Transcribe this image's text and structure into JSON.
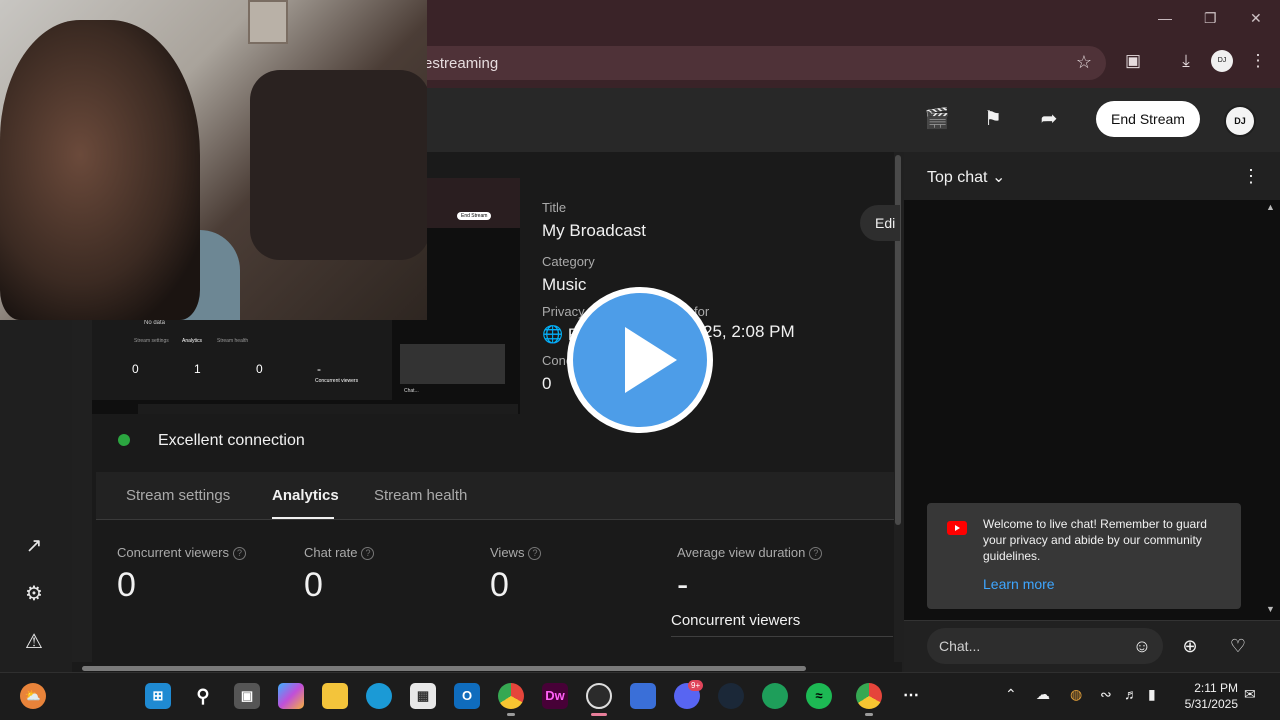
{
  "browser": {
    "url_fragment": "estreaming",
    "window_controls": [
      "minimize-icon",
      "restore-icon",
      "close-icon"
    ]
  },
  "header": {
    "end_stream_label": "End Stream",
    "icons": [
      "clapperboard-icon",
      "bookmark-icon",
      "share-icon"
    ],
    "avatar_text": "DJ"
  },
  "stream_info": {
    "title_label": "Title",
    "title_value": "My Broadcast",
    "category_label": "Category",
    "category_value": "Music",
    "privacy_label": "Privacy",
    "privacy_value": "P",
    "scheduled_label": "for",
    "scheduled_value": "25, 2:08 PM",
    "concurrent_label": "Conc",
    "concurrent_value": "0",
    "edit_label": "Edi"
  },
  "connection": {
    "status": "Excellent connection",
    "color": "#2ba640"
  },
  "tabs": [
    {
      "label": "Stream settings",
      "active": false
    },
    {
      "label": "Analytics",
      "active": true
    },
    {
      "label": "Stream health",
      "active": false
    }
  ],
  "stats": [
    {
      "label": "Concurrent viewers",
      "value": "0"
    },
    {
      "label": "Chat rate",
      "value": "0"
    },
    {
      "label": "Views",
      "value": "0"
    },
    {
      "label": "Average view duration",
      "value": "-"
    }
  ],
  "concurrent_viewers_title": "Concurrent viewers",
  "preview_mini": {
    "no_data": "No data",
    "tabs": [
      "Stream settings",
      "Analytics",
      "Stream health"
    ],
    "stats": [
      "0",
      "1",
      "0",
      "-"
    ],
    "cv": "Concurrent viewers",
    "end_stream": "End Stream",
    "chat": "Chat..."
  },
  "chat": {
    "mode_label": "Top chat",
    "welcome_text": "Welcome to live chat! Remember to guard your privacy and abide by our community guidelines.",
    "learn_more": "Learn more",
    "input_placeholder": "Chat..."
  },
  "taskbar": {
    "apps": [
      "windows-start",
      "search",
      "task-view",
      "copilot",
      "file-explorer",
      "edge",
      "microsoft-store",
      "outlook",
      "chrome",
      "dreamweaver",
      "obs",
      "screen-recorder",
      "discord",
      "steam",
      "kiwix",
      "spotify",
      "chrome-profile",
      "more"
    ],
    "dw_label": "Dw",
    "discord_badge": "9+",
    "time": "2:11 PM",
    "date": "5/31/2025"
  }
}
